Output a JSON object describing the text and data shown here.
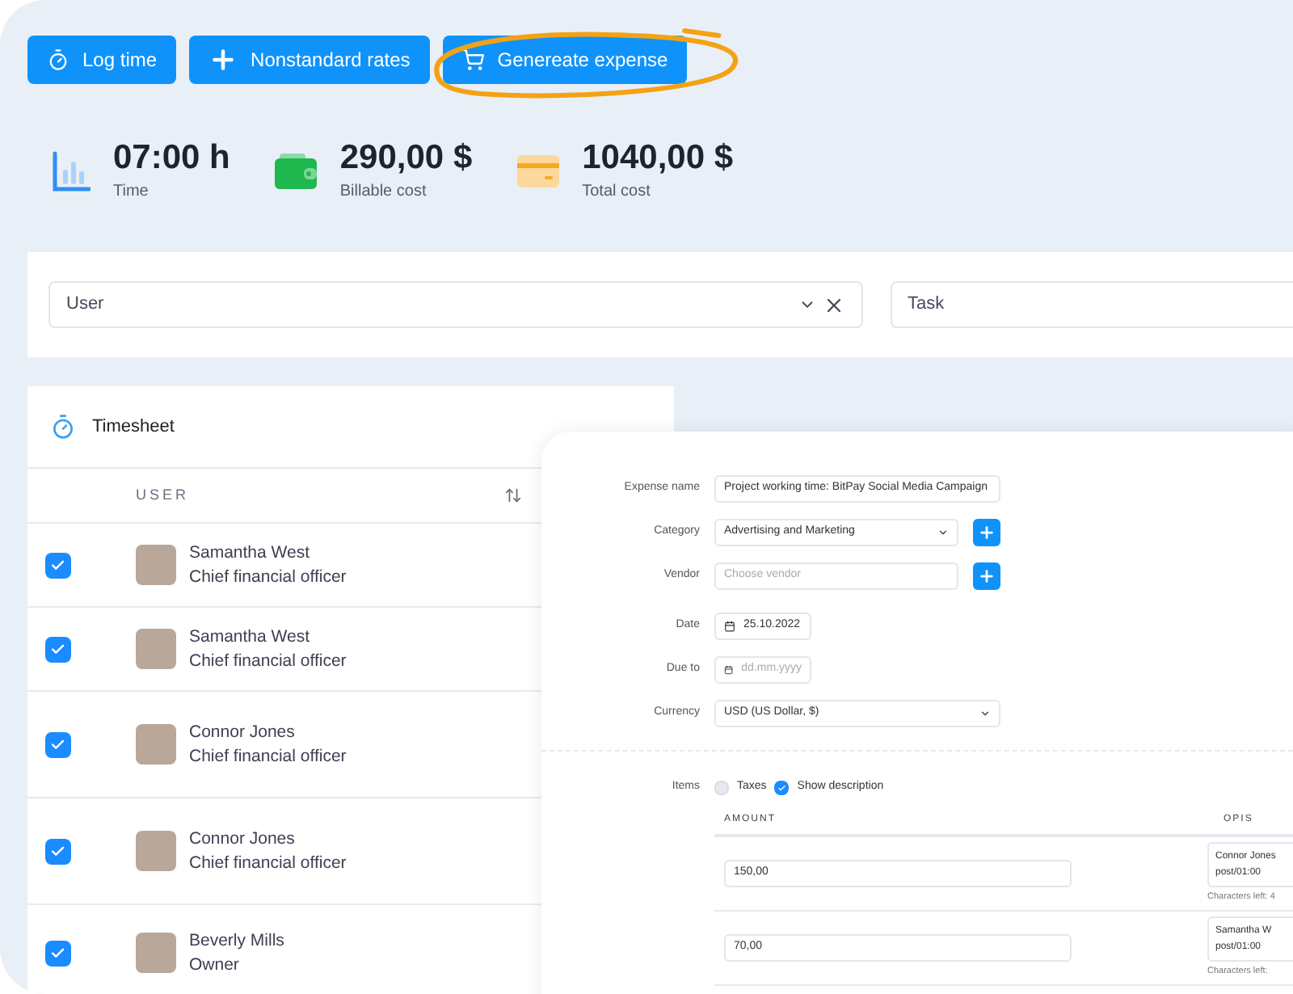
{
  "toolbar": {
    "buttons": [
      {
        "label": "Log time",
        "highlighted": false
      },
      {
        "label": "Nonstandard rates",
        "highlighted": false
      },
      {
        "label": "Genereate expense",
        "highlighted": true
      }
    ]
  },
  "stats": [
    {
      "value": "07:00 h",
      "label": "Time"
    },
    {
      "value": "290,00 $",
      "label": "Billable cost"
    },
    {
      "value": "1040,00 $",
      "label": "Total cost"
    }
  ],
  "filters": [
    {
      "placeholder": "User",
      "clearable": true
    },
    {
      "placeholder": "Task",
      "clearable": false
    }
  ],
  "timesheet": {
    "title": "Timesheet",
    "columns": [
      {
        "label": "USER"
      }
    ],
    "rows": [
      {
        "name": "Samantha West",
        "role": "Chief financial officer",
        "checked": true
      },
      {
        "name": "Samantha West",
        "role": "Chief financial officer",
        "checked": true
      },
      {
        "name": "Connor Jones",
        "role": "Chief financial officer",
        "checked": true
      },
      {
        "name": "Connor Jones",
        "role": "Chief financial officer",
        "checked": true
      },
      {
        "name": "Beverly Mills",
        "role": "Owner",
        "checked": true
      }
    ]
  },
  "expense_form": {
    "fields": [
      {
        "label": "Expense name",
        "kind": "text",
        "value": "Project working time: BitPay Social Media Campaign"
      },
      {
        "label": "Category",
        "kind": "select",
        "value": "Advertising and Marketing",
        "add_button": true
      },
      {
        "label": "Vendor",
        "kind": "text",
        "placeholder": "Choose vendor",
        "add_button": true
      },
      {
        "label": "Date",
        "kind": "date",
        "value": "25.10.2022"
      },
      {
        "label": "Due to",
        "kind": "date",
        "placeholder": "dd.mm.yyyy"
      },
      {
        "label": "Currency",
        "kind": "select",
        "value": "USD (US Dollar, $)"
      }
    ],
    "items": {
      "label": "Items",
      "options": [
        {
          "label": "Taxes",
          "checked": false
        },
        {
          "label": "Show description",
          "checked": true
        }
      ]
    },
    "table": {
      "columns": [
        "AMOUNT",
        "OPIS"
      ],
      "rows": [
        {
          "amount": "150,00",
          "description": [
            "Connor Jones",
            "post/01:00"
          ],
          "note": "Characters left: 4"
        },
        {
          "amount": "70,00",
          "description": [
            "Samantha W",
            "post/01:00"
          ],
          "note": "Characters left:"
        }
      ]
    }
  }
}
